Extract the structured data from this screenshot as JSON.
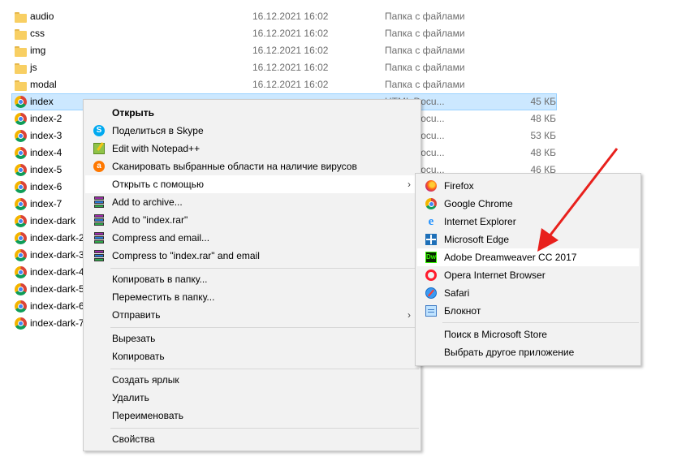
{
  "files": [
    {
      "name": "audio",
      "icon": "folder",
      "date": "16.12.2021 16:02",
      "type": "Папка с файлами",
      "size": ""
    },
    {
      "name": "css",
      "icon": "folder",
      "date": "16.12.2021 16:02",
      "type": "Папка с файлами",
      "size": ""
    },
    {
      "name": "img",
      "icon": "folder",
      "date": "16.12.2021 16:02",
      "type": "Папка с файлами",
      "size": ""
    },
    {
      "name": "js",
      "icon": "folder",
      "date": "16.12.2021 16:02",
      "type": "Папка с файлами",
      "size": ""
    },
    {
      "name": "modal",
      "icon": "folder",
      "date": "16.12.2021 16:02",
      "type": "Папка с файлами",
      "size": ""
    },
    {
      "name": "index",
      "icon": "chrome-html",
      "date": "",
      "type": "HTML Docu...",
      "size": "45 КБ",
      "selected": true
    },
    {
      "name": "index-2",
      "icon": "chrome-html",
      "date": "",
      "type": "HTML Docu...",
      "size": "48 КБ"
    },
    {
      "name": "index-3",
      "icon": "chrome-html",
      "date": "",
      "type": "HTML Docu...",
      "size": "53 КБ"
    },
    {
      "name": "index-4",
      "icon": "chrome-html",
      "date": "",
      "type": "HTML Docu...",
      "size": "48 КБ"
    },
    {
      "name": "index-5",
      "icon": "chrome-html",
      "date": "",
      "type": "HTML Docu...",
      "size": "46 КБ"
    },
    {
      "name": "index-6",
      "icon": "chrome-html",
      "date": "",
      "type": "",
      "size": ""
    },
    {
      "name": "index-7",
      "icon": "chrome-html",
      "date": "",
      "type": "",
      "size": ""
    },
    {
      "name": "index-dark",
      "icon": "chrome-html",
      "date": "",
      "type": "",
      "size": ""
    },
    {
      "name": "index-dark-2",
      "icon": "chrome-html",
      "date": "",
      "type": "",
      "size": ""
    },
    {
      "name": "index-dark-3",
      "icon": "chrome-html",
      "date": "",
      "type": "",
      "size": ""
    },
    {
      "name": "index-dark-4",
      "icon": "chrome-html",
      "date": "",
      "type": "",
      "size": ""
    },
    {
      "name": "index-dark-5",
      "icon": "chrome-html",
      "date": "",
      "type": "",
      "size": ""
    },
    {
      "name": "index-dark-6",
      "icon": "chrome-html",
      "date": "",
      "type": "",
      "size": ""
    },
    {
      "name": "index-dark-7",
      "icon": "chrome-html",
      "date": "",
      "type": "",
      "size": ""
    }
  ],
  "context_menu": {
    "open": "Открыть",
    "share_skype": "Поделиться в Skype",
    "edit_notepadpp": "Edit with Notepad++",
    "scan_virus": "Сканировать выбранные области на наличие вирусов",
    "open_with": "Открыть с помощью",
    "add_archive": "Add to archive...",
    "add_rar": "Add to \"index.rar\"",
    "compress_email": "Compress and email...",
    "compress_rar_email": "Compress to \"index.rar\" and email",
    "copy_to": "Копировать в папку...",
    "move_to": "Переместить в папку...",
    "send_to": "Отправить",
    "cut": "Вырезать",
    "copy": "Копировать",
    "create_shortcut": "Создать ярлык",
    "delete": "Удалить",
    "rename": "Переименовать",
    "properties": "Свойства"
  },
  "open_with_menu": {
    "firefox": "Firefox",
    "chrome": "Google Chrome",
    "ie": "Internet Explorer",
    "edge": "Microsoft Edge",
    "dreamweaver": "Adobe Dreamweaver CC 2017",
    "opera": "Opera Internet Browser",
    "safari": "Safari",
    "notepad": "Блокнот",
    "store_search": "Поиск в Microsoft Store",
    "choose_other": "Выбрать другое приложение"
  },
  "icons": {
    "dreamweaver_text": "Dw",
    "skype_text": "S",
    "avast_text": "a",
    "ie_text": "e",
    "submenu_arrow": "›"
  },
  "colors": {
    "selection_bg": "#cce8ff",
    "menu_bg": "#f2f2f2",
    "annotation_arrow": "#e8201c"
  }
}
